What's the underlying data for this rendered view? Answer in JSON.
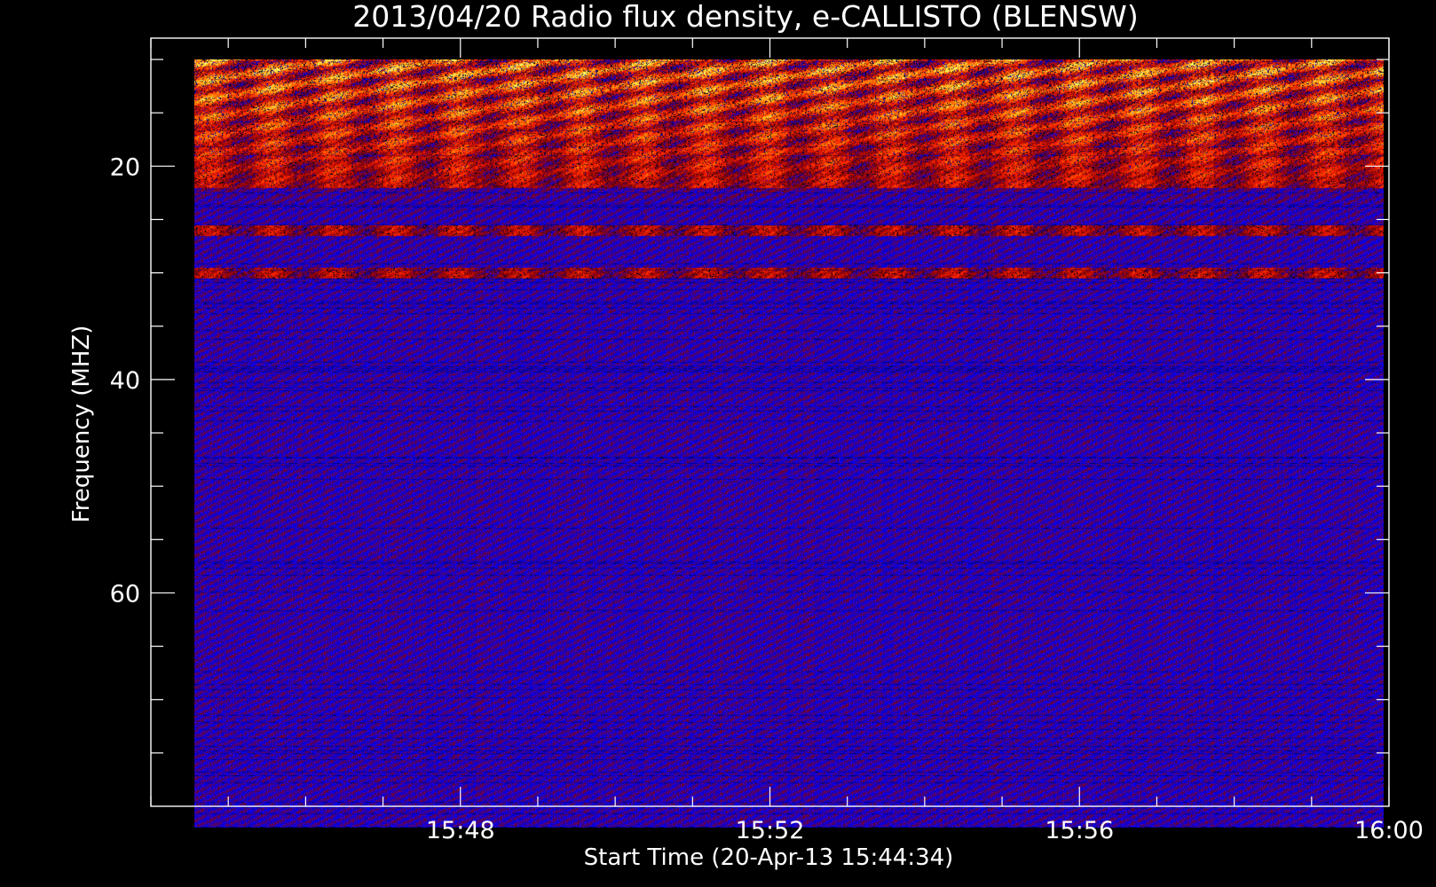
{
  "chart_data": {
    "type": "heatmap",
    "title": "2013/04/20  Radio flux density, e-CALLISTO (BLENSW)",
    "xlabel": "Start Time (20-Apr-13 15:44:34)",
    "ylabel": "Frequency (MHZ)",
    "x_ticks": [
      "15:48",
      "15:52",
      "15:56",
      "16:00"
    ],
    "y_ticks": [
      20,
      40,
      60
    ],
    "xlim": [
      "15:44:00",
      "16:00:00"
    ],
    "ylim": [
      80,
      8
    ],
    "data_extent": {
      "time_start": "15:44:34",
      "time_end": "15:59:56",
      "freq_min_mhz": 10,
      "freq_max_mhz": 82
    },
    "colorscale": [
      "#000000",
      "#0000ff",
      "#8b0000",
      "#ff2000",
      "#ff8c00",
      "#ffff66"
    ],
    "features": [
      {
        "label": "intense emission band",
        "freq_range_mhz": [
          10,
          22
        ]
      },
      {
        "label": "emission band",
        "freq_range_mhz": [
          25.5,
          26.5
        ]
      },
      {
        "label": "intermittent emission",
        "freq_range_mhz": [
          29.5,
          30.5
        ]
      }
    ],
    "grid": false,
    "legend": "none"
  }
}
